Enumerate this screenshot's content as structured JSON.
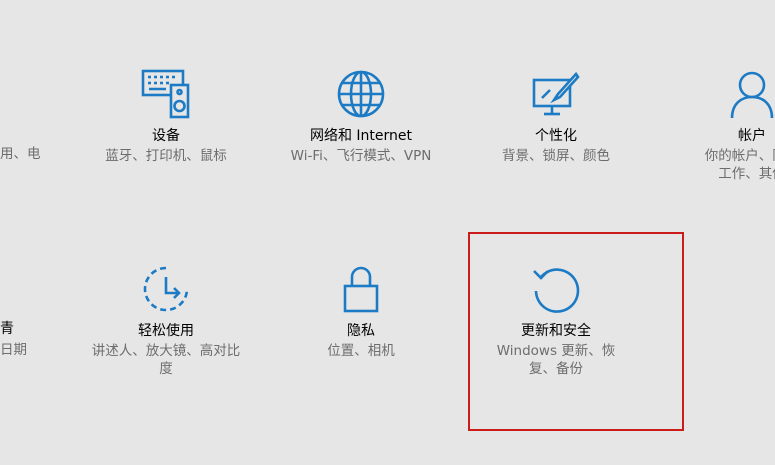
{
  "left_column": {
    "row1_desc": "用、电",
    "row2_title": "青",
    "row2_desc": "日期"
  },
  "tiles": {
    "devices": {
      "title": "设备",
      "desc": "蓝牙、打印机、鼠标",
      "icon": "keyboard-speaker-icon"
    },
    "network": {
      "title": "网络和 Internet",
      "desc": "Wi-Fi、飞行模式、VPN",
      "icon": "globe-icon"
    },
    "personalization": {
      "title": "个性化",
      "desc": "背景、锁屏、颜色",
      "icon": "monitor-paintbrush-icon"
    },
    "accounts": {
      "title": "帐户",
      "desc_line1": "你的帐户、同步",
      "desc_line2": "工作、其他",
      "icon": "person-icon"
    },
    "ease_of_access": {
      "title": "轻松使用",
      "desc": "讲述人、放大镜、高对比度",
      "icon": "ease-of-access-icon"
    },
    "privacy": {
      "title": "隐私",
      "desc": "位置、相机",
      "icon": "lock-icon"
    },
    "update_security": {
      "title": "更新和安全",
      "desc": "Windows 更新、恢复、备份",
      "icon": "refresh-icon"
    }
  },
  "colors": {
    "background": "#e6e6e6",
    "accent": "#1c7bc4",
    "highlight_border": "#cc1b1b",
    "secondary_text": "#6d6d6d"
  }
}
